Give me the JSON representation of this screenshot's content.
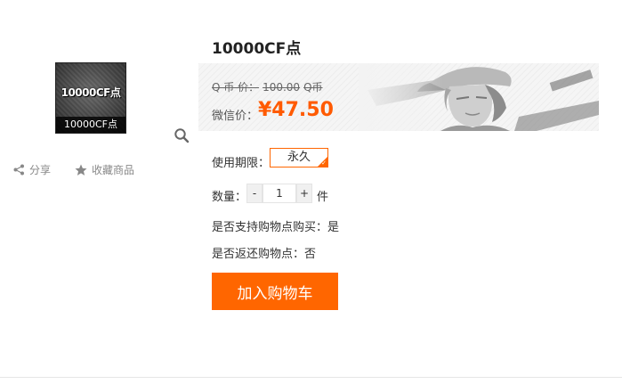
{
  "product": {
    "thumbnail_big_text": "10000CF点",
    "thumbnail_caption": "10000CF点",
    "title": "10000CF点"
  },
  "actions": {
    "share_label": "分享",
    "favorite_label": "收藏商品"
  },
  "price": {
    "original_label": "Q 币 价：",
    "original_value": "100.00",
    "original_unit": "Q币",
    "wechat_label": "微信价：",
    "wechat_value": "¥47.50"
  },
  "options": {
    "period_label": "使用期限：",
    "period_selected": "永久",
    "quantity_label": "数量：",
    "quantity_minus": "-",
    "quantity_value": "1",
    "quantity_plus": "+",
    "quantity_unit": "件",
    "points_buy_label": "是否支持购物点购买：是",
    "points_return_label": "是否返还购物点：否"
  },
  "cart_button": "加入购物车",
  "icons": {
    "zoom": "search-icon",
    "share": "share-icon",
    "favorite": "star-icon",
    "check": "check-icon"
  },
  "colors": {
    "accent": "#ff6600",
    "price": "#ff5a00"
  }
}
